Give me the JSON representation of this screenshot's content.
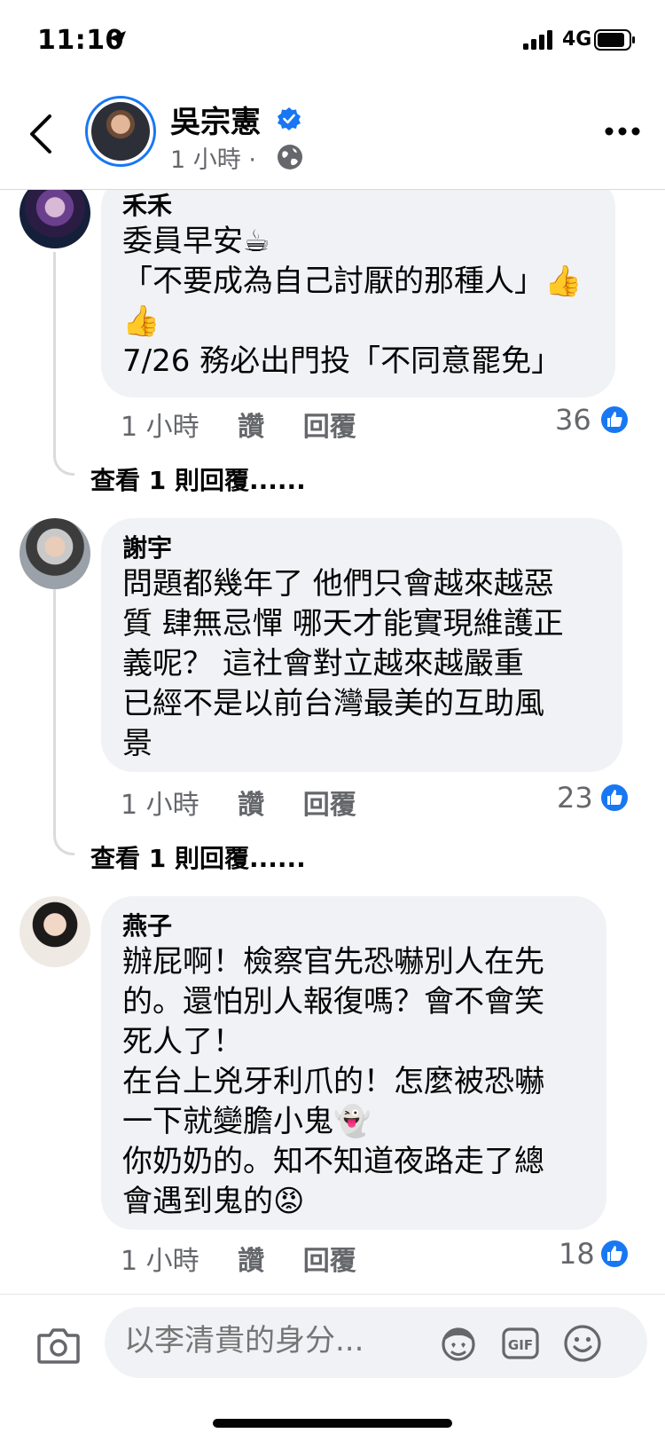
{
  "status_bar": {
    "time": "11:10",
    "network": "4G"
  },
  "header": {
    "name": "吳宗憲",
    "meta": "1 小時 ·"
  },
  "comments": [
    {
      "name": "禾禾",
      "lines": [
        "委員早安☕",
        "「不要成為自己討厭的那種人」👍",
        "👍",
        "7/26 務必出門投「不同意罷免」"
      ],
      "time": "1 小時",
      "like_label": "讚",
      "reply_label": "回覆",
      "likes": "36",
      "view_replies": "查看 1 則回覆......"
    },
    {
      "name": "謝宇",
      "lines": [
        "問題都幾年了 他們只會越來越惡",
        "質 肆無忌憚 哪天才能實現維護正",
        "義呢？  這社會對立越來越嚴重",
        "已經不是以前台灣最美的互助風",
        "景"
      ],
      "time": "1 小時",
      "like_label": "讚",
      "reply_label": "回覆",
      "likes": "23",
      "view_replies": "查看 1 則回覆......"
    },
    {
      "name": "燕子",
      "lines": [
        "辦屁啊！檢察官先恐嚇別人在先",
        "的。還怕別人報復嗎？會不會笑",
        "死人了！",
        "在台上兇牙利爪的！怎麼被恐嚇",
        "一下就變膽小鬼👻",
        "你奶奶的。知不知道夜路走了總",
        "會遇到鬼的😡"
      ],
      "time": "1 小時",
      "like_label": "讚",
      "reply_label": "回覆",
      "likes": "18"
    }
  ],
  "composer": {
    "placeholder": "以李清貴的身分..."
  },
  "colors": {
    "accent": "#1877f2",
    "bubble": "#f0f2f5",
    "secondary_text": "#65676b"
  }
}
